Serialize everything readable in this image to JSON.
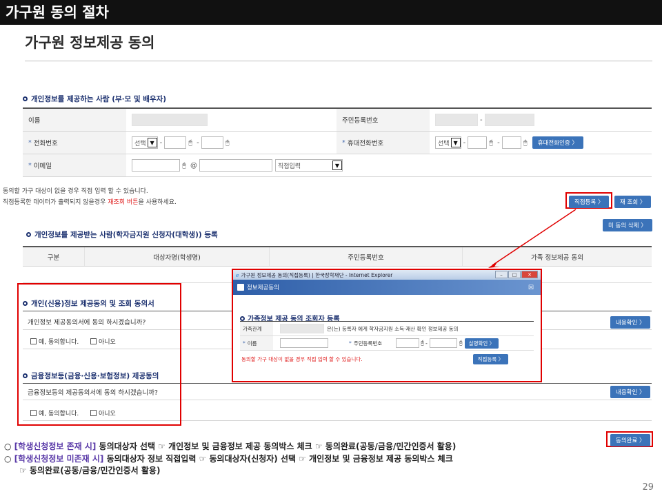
{
  "slide": {
    "header": "가구원 동의 절차",
    "title": "가구원 정보제공 동의",
    "page_number": "29"
  },
  "provider": {
    "section_title": "개인정보를 제공하는 사람 (부·모 및 배우자)",
    "name_label": "이름",
    "rrn_label": "주민등록번호",
    "phone_label": "전화번호",
    "mobile_label": "휴대전화번호",
    "email_label": "이메일",
    "select_text": "선택",
    "direct_input": "직접입력",
    "dash": "-",
    "at": "@",
    "mobile_auth_button": "휴대전화인증 〉"
  },
  "notice": {
    "line1": "동의할 가구 대상이 없을 경우 직접 입력 할 수 있습니다.",
    "line2_a": "직접등록한 데이터가 출력되지 않을경우 ",
    "line2_b": "재조회 버튼",
    "line2_c": "을 사용하세요."
  },
  "buttons": {
    "direct_register": "직접등록 〉",
    "re_query": "재 조회 〉",
    "unconsent_delete": "미 동의 삭제 〉",
    "view_content_1": "내용확인 〉",
    "view_content_2": "내용확인 〉",
    "consent_complete": "동의완료 〉"
  },
  "receiver": {
    "section_title": "개인정보를 제공받는 사람(학자금지원 신청자(대학생)) 등록",
    "columns": [
      "구분",
      "대상자명(학생명)",
      "주민등록번호",
      "가족 정보제공 동의"
    ]
  },
  "consent1": {
    "title": "개인(신용)정보 제공동의 및 조회 동의서",
    "question": "개인정보 제공동의서에 동의 하시겠습니까?",
    "yes": "예, 동의합니다.",
    "no": "아니오"
  },
  "consent2": {
    "title": "금융정보등(금융·신용·보험정보) 제공동의",
    "question": "금융정보등의 제공동의서에 동의 하시겠습니까?",
    "yes": "예, 동의합니다.",
    "no": "아니오"
  },
  "popup": {
    "window_title": "가구원 정보제공 동의(직접등록) | 한국장학재단 - Internet Explorer",
    "header": "정보제공동의",
    "section_title": "가족정보 제공 동의 조회자 등록",
    "family_label": "가족관계",
    "family_text": "은(는) 등록자 에게 학자금지원 소득·재산 확인 정보제공 동의",
    "name_label": "이름",
    "rrn_label": "주민등록번호",
    "verify_button": "실명확인 〉",
    "notice": "동의할 가구 대상이 없을 경우 직접 입력 할 수 있습니다.",
    "register_button": "직접등록 〉",
    "dash": "-"
  },
  "instructions": {
    "line1_mark": "○",
    "line1_hl": "[학생신청정보 존재 시]",
    "line1_text": "동의대상자 선택 ☞ 개인정보 및 금융정보 제공 동의박스 체크 ☞ 동의완료(공동/금융/민간인증서 활용)",
    "line2_mark": "○",
    "line2_hl": "[학생신청정보 미존재 시]",
    "line2_text": "동의대상자 정보 직접입력 ☞ 동의대상자(신청자) 선택 ☞ 개인정보 및 금융정보 제공 동의박스 체크",
    "line3_text": "☞ 동의완료(공동/금융/민간인증서 활용)"
  },
  "colors": {
    "accent_blue": "#3b73b9",
    "highlight_red": "#e00000",
    "header_bg": "#111111",
    "instruction_highlight": "#5a3aa8"
  }
}
